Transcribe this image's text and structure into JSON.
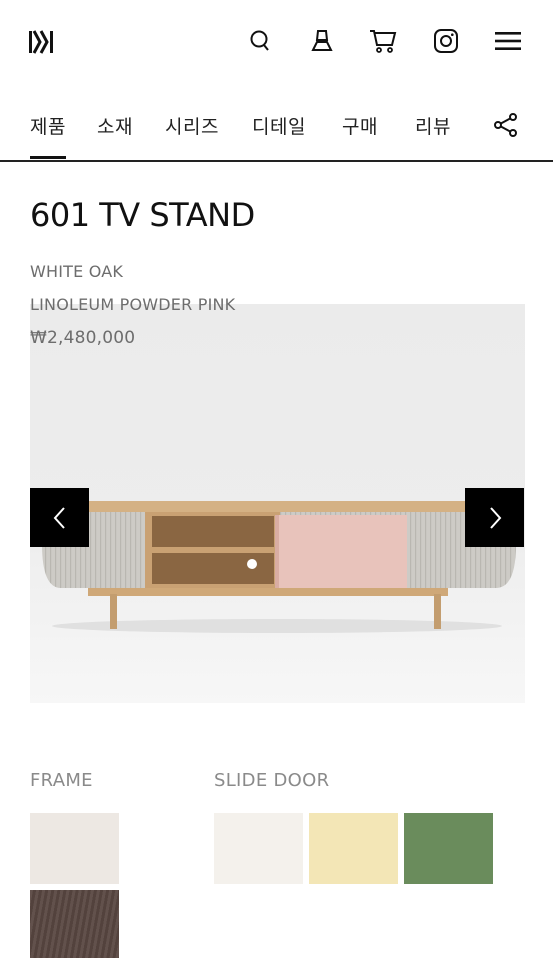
{
  "brand": {
    "logo_icon": "kontemporary-logo-icon"
  },
  "header_icons": [
    "search-icon",
    "lamp-icon",
    "cart-icon",
    "instagram-icon",
    "menu-icon"
  ],
  "tabs": [
    {
      "label": "제품",
      "active": true
    },
    {
      "label": "소재",
      "active": false
    },
    {
      "label": "시리즈",
      "active": false
    },
    {
      "label": "디테일",
      "active": false
    },
    {
      "label": "구매",
      "active": false
    },
    {
      "label": "리뷰",
      "active": false
    }
  ],
  "product": {
    "title": "601 TV STAND",
    "frame_material": "WHITE OAK",
    "door_material": "LINOLEUM POWDER PINK",
    "price": "₩2,480,000"
  },
  "options": {
    "frame_label": "FRAME",
    "slide_door_label": "SLIDE DOOR",
    "frame_swatches": [
      {
        "name": "light-oak",
        "color": "#ede8e3"
      },
      {
        "name": "dark-walnut",
        "color": "#5a4842"
      }
    ],
    "door_swatches": [
      {
        "name": "off-white",
        "color": "#f4f1ec"
      },
      {
        "name": "butter-yellow",
        "color": "#f3e6b6"
      },
      {
        "name": "olive-green",
        "color": "#6a8c5c"
      }
    ]
  },
  "colors": {
    "accent": "#111111",
    "muted_text": "#6d6d6d",
    "pink_door": "#e8c3bb",
    "oak": "#d8b48a"
  }
}
